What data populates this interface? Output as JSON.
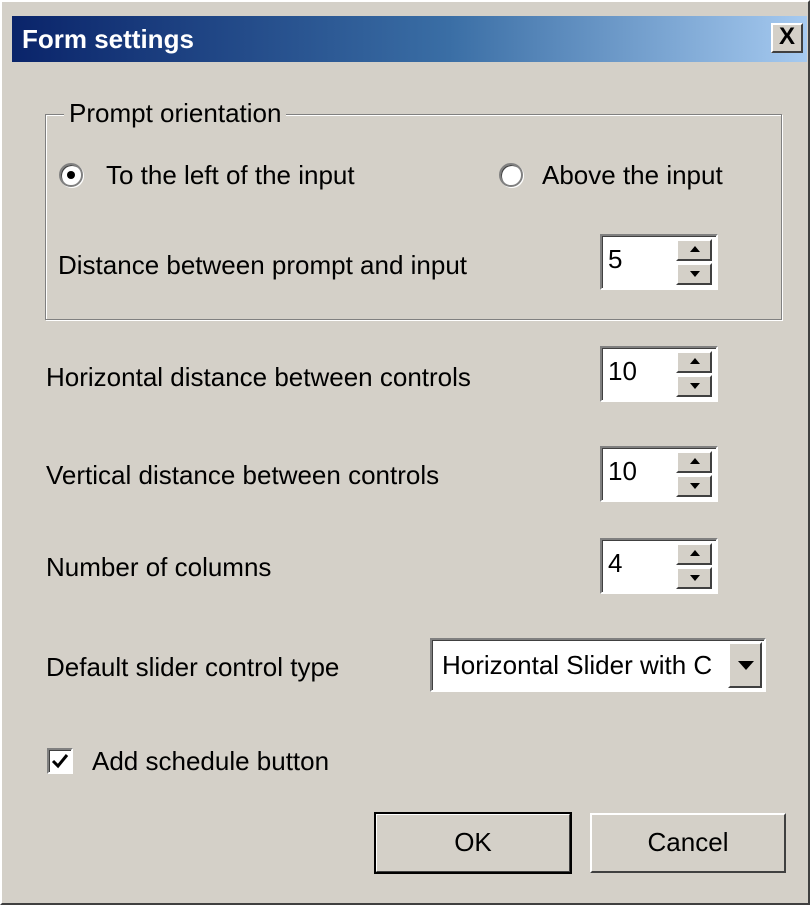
{
  "window": {
    "title": "Form settings",
    "close_label": "X"
  },
  "prompt_orientation": {
    "legend": "Prompt orientation",
    "options": [
      {
        "label": "To the left of the input",
        "selected": true
      },
      {
        "label": "Above the input",
        "selected": false
      }
    ],
    "distance_label": "Distance between prompt and input",
    "distance_value": "5"
  },
  "fields": {
    "horizontal_label": "Horizontal distance between controls",
    "horizontal_value": "10",
    "vertical_label": "Vertical distance between controls",
    "vertical_value": "10",
    "columns_label": "Number of columns",
    "columns_value": "4",
    "slider_label": "Default slider control type",
    "slider_value": "Horizontal Slider with C"
  },
  "schedule": {
    "label": "Add schedule button",
    "checked": true
  },
  "buttons": {
    "ok": "OK",
    "cancel": "Cancel"
  }
}
